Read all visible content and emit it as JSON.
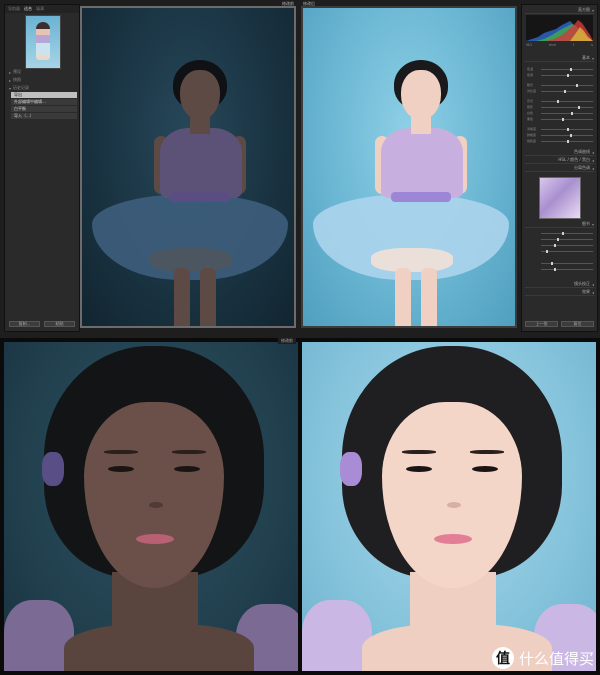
{
  "top_window": {
    "left_panel": {
      "tabs": [
        "导航器",
        "适合",
        "填满"
      ],
      "sections": [
        "预设",
        "快照",
        "历史记录"
      ],
      "history_items": [
        "导出",
        "外部编辑中编辑...",
        "白平衡",
        "导入（...）"
      ],
      "buttons": [
        "复制...",
        "粘贴"
      ]
    },
    "panel_labels": {
      "before": "修改前",
      "after": "修改后"
    },
    "right_panel": {
      "header": "直方图",
      "hist_info": [
        "ISO",
        "mm",
        "f",
        "s"
      ],
      "sections": [
        "基本",
        "色调曲线",
        "HSL / 颜色 / 黑白",
        "分离色调",
        "细节",
        "镜头校正",
        "效果"
      ],
      "sliders": [
        "色温",
        "色调",
        "曝光",
        "对比度",
        "高光",
        "阴影",
        "白色",
        "黑色",
        "清晰度",
        "鲜艳度",
        "饱和度"
      ],
      "buttons": [
        "上一张",
        "复位"
      ]
    }
  },
  "bottom_label": "修改前",
  "watermark": {
    "badge": "值",
    "text": "什么值得买"
  },
  "colors": {
    "app_bg": "#1e1e1e",
    "before_bg": "#1a3443",
    "after_bg": "#6ab6d3"
  }
}
